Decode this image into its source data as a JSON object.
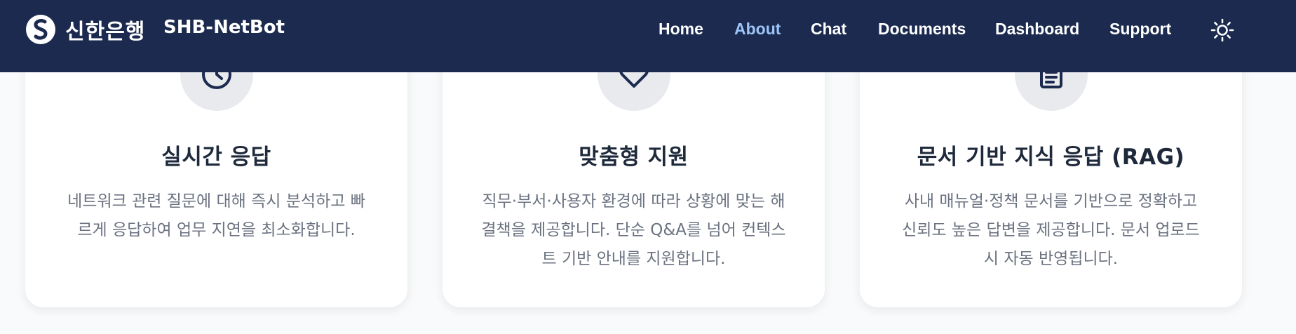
{
  "navbar": {
    "brand_korean": "신한은행",
    "brand_product": "SHB-NetBot",
    "links": [
      {
        "label": "Home",
        "active": false
      },
      {
        "label": "About",
        "active": true
      },
      {
        "label": "Chat",
        "active": false
      },
      {
        "label": "Documents",
        "active": false
      },
      {
        "label": "Dashboard",
        "active": false
      },
      {
        "label": "Support",
        "active": false
      }
    ],
    "theme_toggle_icon": "sun-icon"
  },
  "features": [
    {
      "icon": "clock-icon",
      "title": "실시간 응답",
      "description": "네트워크 관련 질문에 대해 즉시 분석하고 빠르게 응답하여 업무 지연을 최소화합니다."
    },
    {
      "icon": "heart-icon",
      "title": "맞춤형 지원",
      "description": "직무·부서·사용자 환경에 따라 상황에 맞는 해결책을 제공합니다. 단순 Q&A를 넘어 컨텍스트 기반 안내를 지원합니다."
    },
    {
      "icon": "clipboard-icon",
      "title": "문서 기반 지식 응답 (RAG)",
      "description": "사내 매뉴얼·정책 문서를 기반으로 정확하고 신뢰도 높은 답변을 제공합니다. 문서 업로드 시 자동 반영됩니다."
    }
  ],
  "colors": {
    "navbar_bg": "#1b2a4e",
    "active_link": "#9ec5f8",
    "card_title": "#1e293b",
    "card_text": "#6b7280",
    "icon_circle_bg": "#e8eaee"
  }
}
